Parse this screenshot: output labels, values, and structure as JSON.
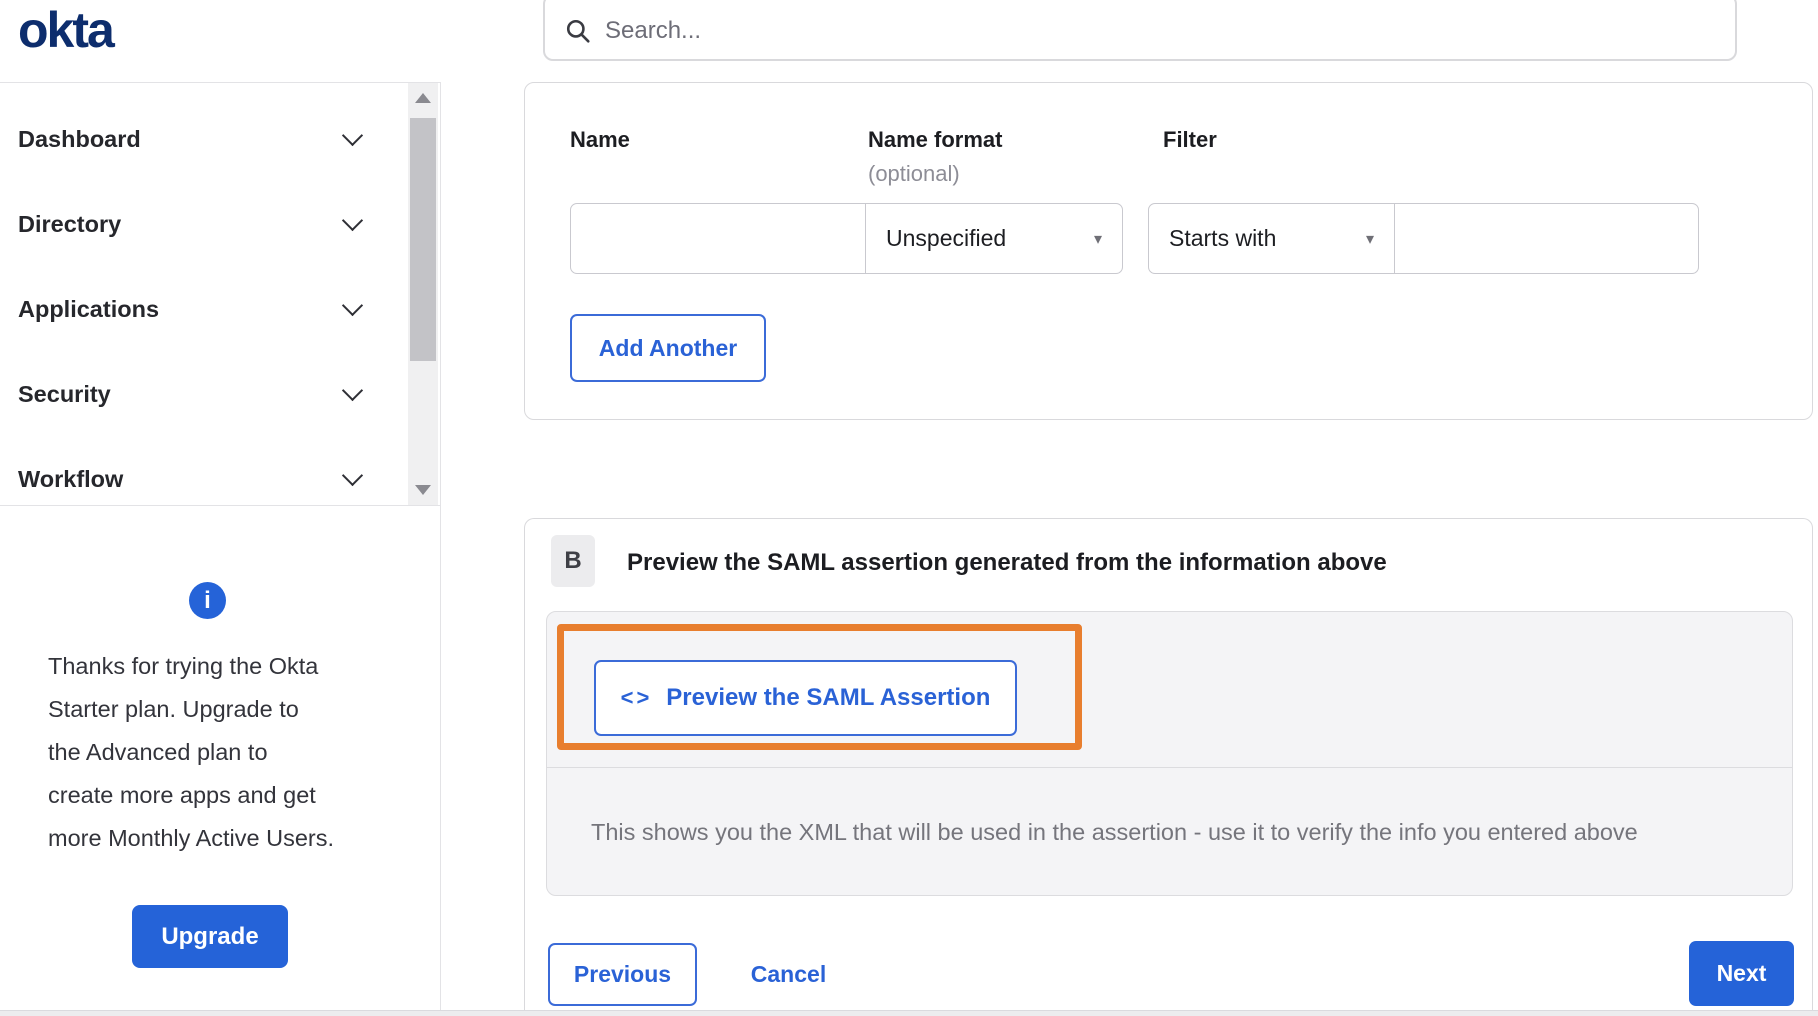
{
  "brand": {
    "logo": "okta"
  },
  "header": {
    "search_placeholder": "Search..."
  },
  "sidebar": {
    "items": [
      {
        "label": "Dashboard"
      },
      {
        "label": "Directory"
      },
      {
        "label": "Applications"
      },
      {
        "label": "Security"
      },
      {
        "label": "Workflow"
      }
    ],
    "upsell": {
      "info_icon": "i",
      "lines": [
        "Thanks for trying the Okta",
        "Starter plan. Upgrade to",
        "the Advanced plan to",
        "create more apps and get",
        "more Monthly Active Users."
      ],
      "upgrade_label": "Upgrade"
    }
  },
  "attribute_form": {
    "name_label": "Name",
    "name_format_label": "Name format",
    "name_format_hint": "(optional)",
    "filter_label": "Filter",
    "name_format_value": "Unspecified",
    "filter_op_value": "Starts with",
    "add_another_label": "Add Another"
  },
  "preview_section": {
    "badge": "B",
    "title": "Preview the SAML assertion generated from the information above",
    "preview_icon": "<>",
    "preview_label": "Preview the SAML Assertion",
    "description": "This shows you the XML that will be used in the assertion - use it to verify the info you entered above"
  },
  "footer": {
    "previous_label": "Previous",
    "cancel_label": "Cancel",
    "next_label": "Next"
  },
  "icons": {
    "dropdown_arrow": "▾"
  },
  "colors": {
    "accent_blue": "#2563d8",
    "outline_blue": "#3b6bd8",
    "logo_navy": "#0d2d6d",
    "highlight_orange": "#e87e2e"
  }
}
